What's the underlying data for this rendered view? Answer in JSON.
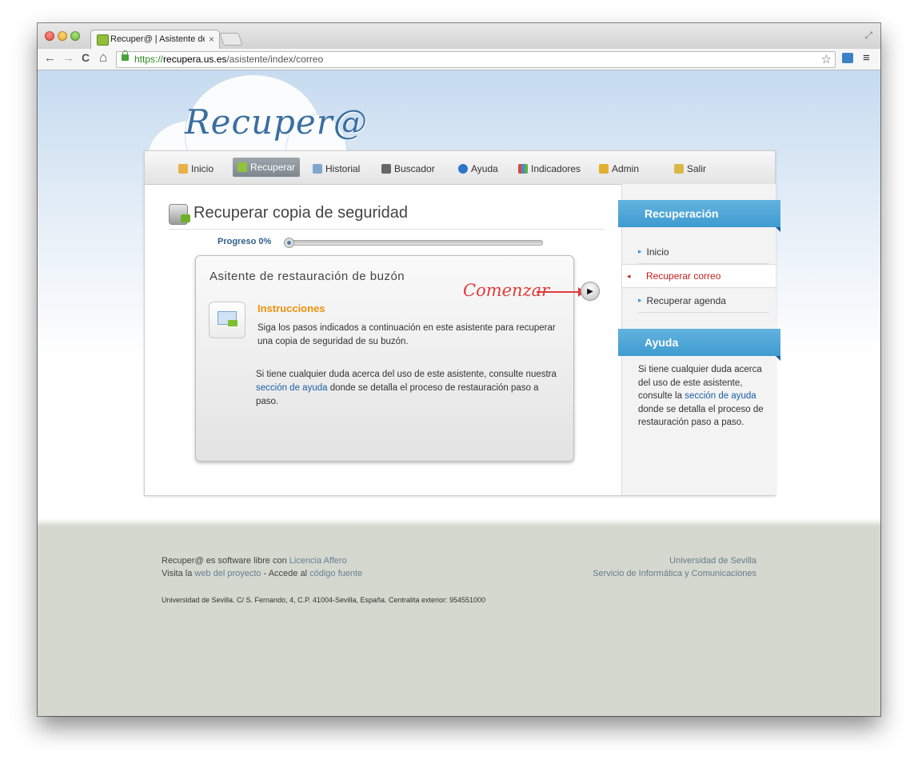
{
  "browser": {
    "tab_title": "Recuper@ | Asistente de re",
    "tab_close": "×",
    "url_scheme": "https://",
    "url_host": "recupera.us.es",
    "url_path": "/asistente/index/correo",
    "back": "←",
    "forward": "→",
    "reload": "C",
    "home": "⌂",
    "star": "☆",
    "menu": "≡",
    "fullscreen": "⤢"
  },
  "header": {
    "logo": "Recuper@"
  },
  "nav": {
    "items": [
      {
        "label": "Inicio",
        "icon": "home-icon"
      },
      {
        "label": "Recuperar",
        "icon": "database-icon",
        "active": true
      },
      {
        "label": "Historial",
        "icon": "history-icon"
      },
      {
        "label": "Buscador",
        "icon": "binoculars-icon"
      },
      {
        "label": "Ayuda",
        "icon": "help-icon"
      },
      {
        "label": "Indicadores",
        "icon": "chart-icon"
      },
      {
        "label": "Admin",
        "icon": "key-icon"
      },
      {
        "label": "Salir",
        "icon": "lock-icon"
      }
    ]
  },
  "main": {
    "title": "Recuperar copia de seguridad",
    "progress_label": "Progreso 0%",
    "progress_value": 0
  },
  "wizard": {
    "title": "Asitente de restauración de buzón",
    "instructions_title": "Instrucciones",
    "instructions_text": "Siga los pasos indicados a continuación en este asistente para recuperar una copia de seguridad de su buzón.",
    "help_pre": "Si tiene cualquier duda acerca del uso de este asistente, consulte nuestra ",
    "help_link": "sección de ayuda",
    "help_post": " donde se detalla el proceso de restauración paso a paso.",
    "start_annotation": "Comenzar",
    "play": "▶"
  },
  "sidebar": {
    "recovery_title": "Recuperación",
    "items": [
      {
        "label": "Inicio"
      },
      {
        "label": "Recuperar correo",
        "active": true
      },
      {
        "label": "Recuperar agenda"
      }
    ],
    "help_title": "Ayuda",
    "help_pre": "Si tiene cualquier duda acerca del uso de este asistente, consulte la ",
    "help_link": "sección de ayuda",
    "help_post": " donde se detalla el proceso de restauración paso a paso."
  },
  "footer": {
    "line1_pre": "Recuper@ es software libre con ",
    "line1_link": "Licencia Affero",
    "line2_pre": "Visita la ",
    "line2_link1": "web del proyecto",
    "line2_mid": " - Accede al ",
    "line2_link2": "código fuente",
    "address": "Universidad de Sevilla. C/ S. Fernando, 4, C.P. 41004-Sevilla, España. Centralita exterior: 954551000",
    "right1": "Universidad de Sevilla",
    "right2": "Servicio de Informática y Comunicaciones"
  },
  "colors": {
    "accent_blue": "#3e9bcf",
    "active_red": "#c41d1d",
    "instructions_orange": "#f0900b",
    "annotation_red": "#e03a3a"
  }
}
